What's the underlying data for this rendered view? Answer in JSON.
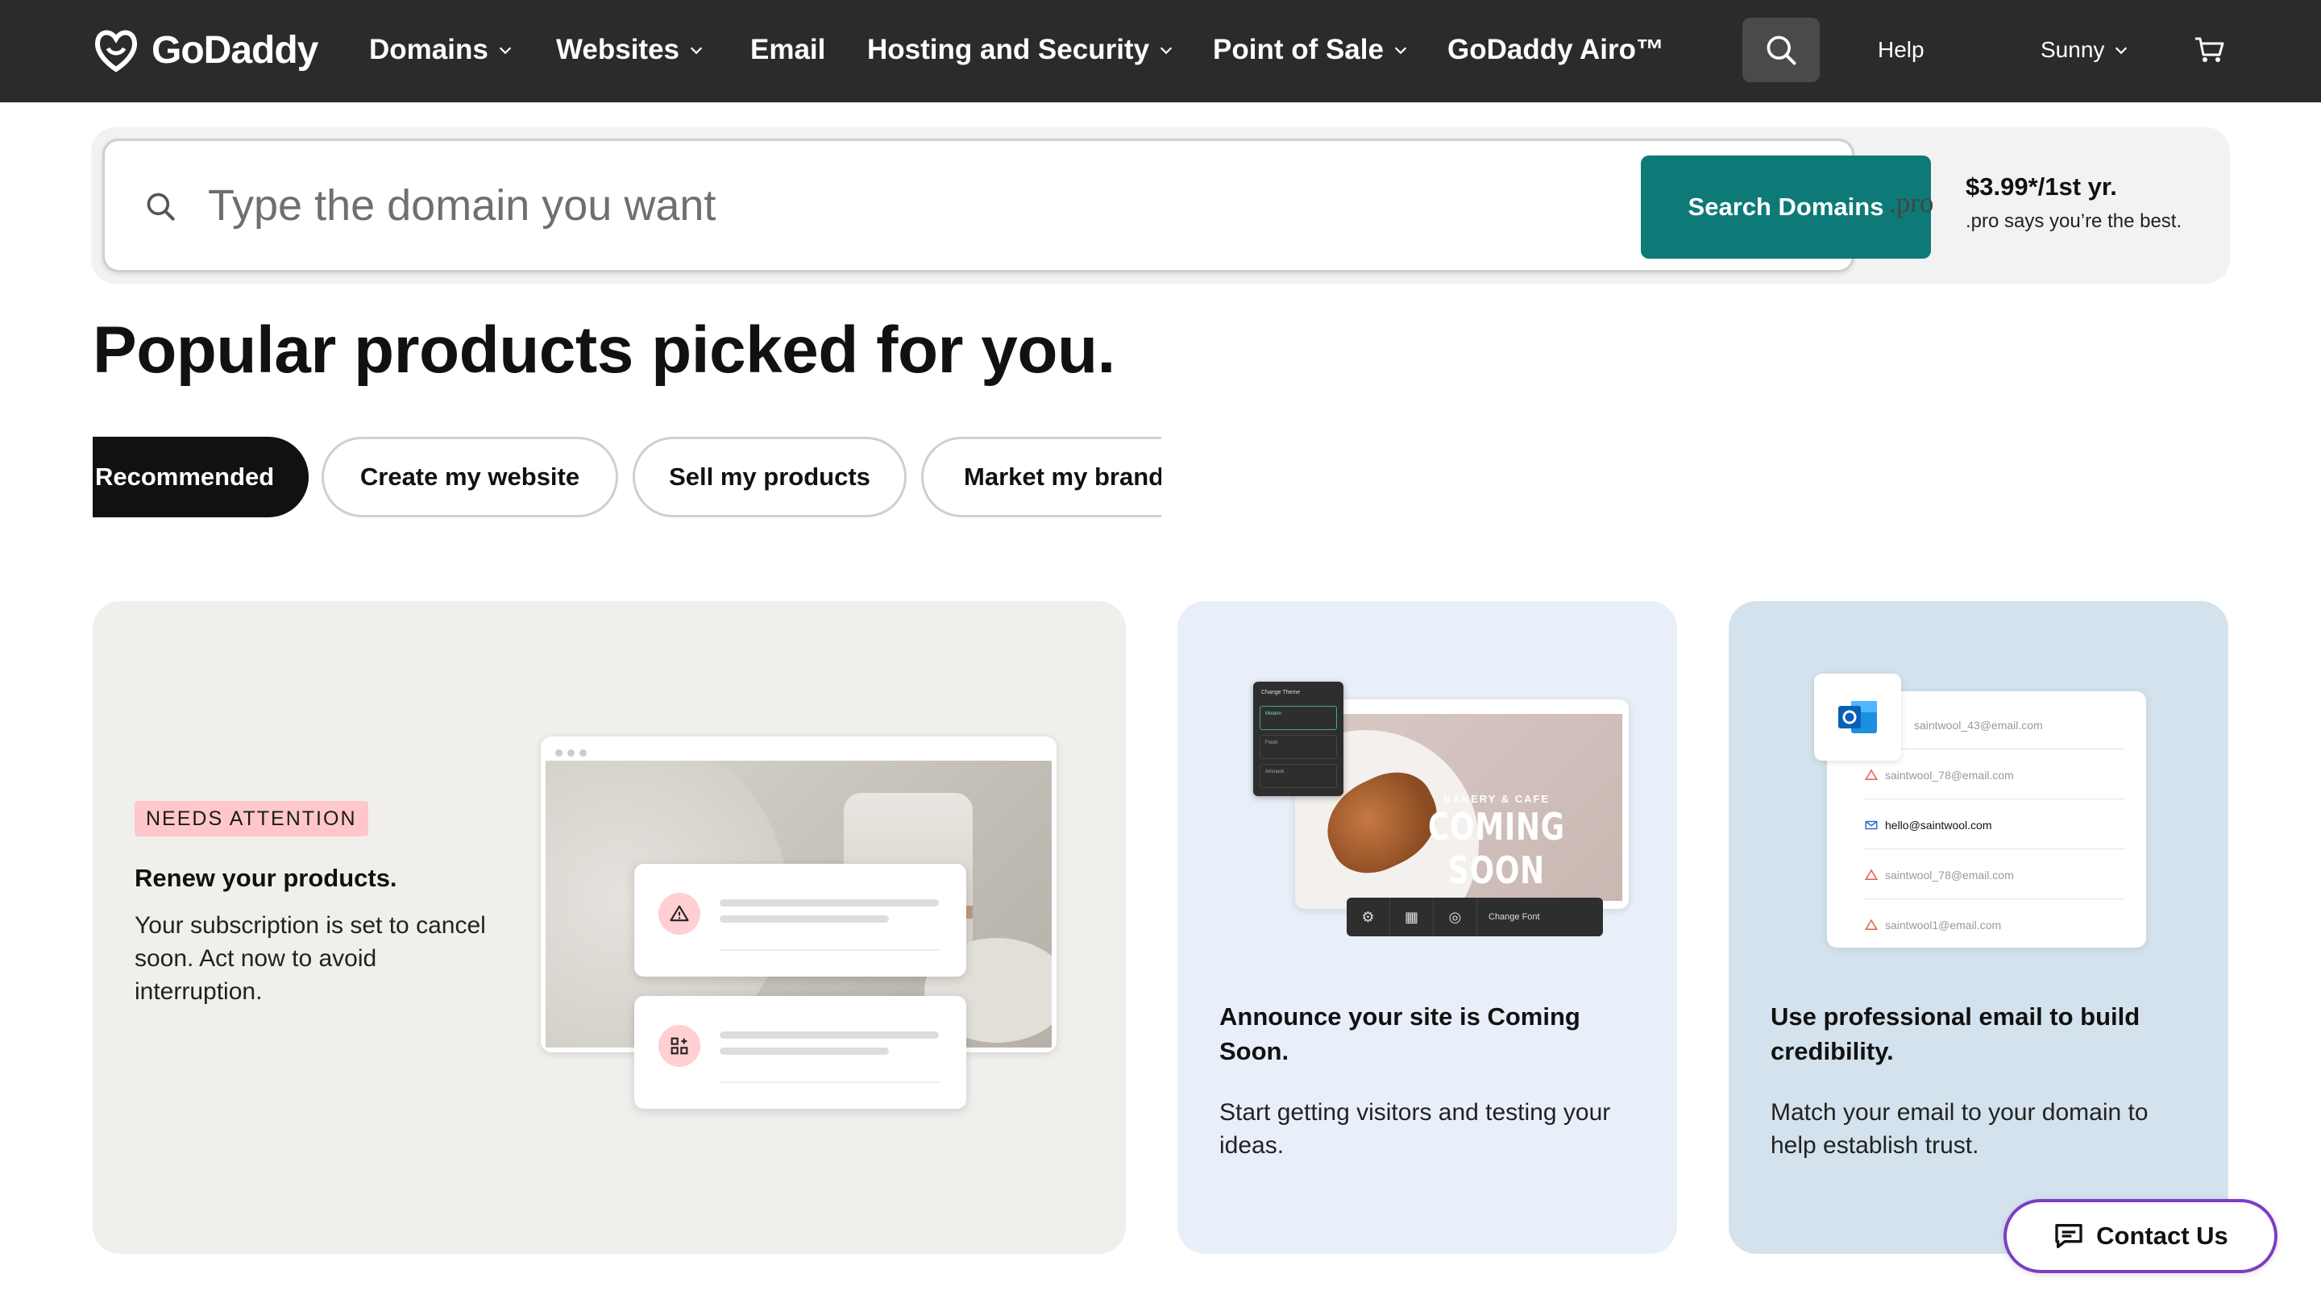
{
  "nav": {
    "logo_text": "GoDaddy",
    "items": [
      {
        "label": "Domains"
      },
      {
        "label": "Websites"
      },
      {
        "label": "Email"
      },
      {
        "label": "Hosting and Security"
      },
      {
        "label": "Point of Sale"
      },
      {
        "label": "GoDaddy Airo™"
      }
    ],
    "help": "Help",
    "user": "Sunny",
    "icons": {
      "search": "search-icon",
      "cart": "cart-icon",
      "chevron": "chevron-down-icon"
    }
  },
  "search": {
    "placeholder": "Type the domain you want",
    "button": "Search Domains",
    "promo_logo": ".pro",
    "promo_price": "$3.99*/1st yr.",
    "promo_text": ".pro says you’re the best."
  },
  "heading": "Popular products picked for you.",
  "tabs": [
    {
      "label": "Recommended",
      "active": true
    },
    {
      "label": "Create my website",
      "active": false
    },
    {
      "label": "Sell my products",
      "active": false
    },
    {
      "label": "Market my brand",
      "active": false
    }
  ],
  "cards": [
    {
      "badge": "NEEDS ATTENTION",
      "title": "Renew your products.",
      "desc": "Your subscription is set to cancel soon. Act now to avoid interruption."
    },
    {
      "title": "Announce your site is Coming Soon.",
      "desc": "Start getting visitors and testing your ideas.",
      "illustration": {
        "panel_title": "Change Theme",
        "options": [
          "Modern",
          "Fresh",
          "Artsnack"
        ],
        "tagline": "BAKERY & CAFE",
        "headline": "COMING SOON",
        "toolbar_font": "Change Font"
      }
    },
    {
      "title": "Use professional email to build credibility.",
      "desc": "Match your email to your domain to help establish trust.",
      "illustration": {
        "emails": [
          {
            "text": "saintwool_43@email.com",
            "status": "warning"
          },
          {
            "text": "saintwool_78@email.com",
            "status": "warning"
          },
          {
            "text": "hello@saintwool.com",
            "status": "ok"
          },
          {
            "text": "saintwool_78@email.com",
            "status": "warning"
          },
          {
            "text": "saintwool1@email.com",
            "status": "warning"
          }
        ]
      }
    }
  ],
  "contact": "Contact Us",
  "colors": {
    "nav_bg": "#2b2b2b",
    "teal": "#0d7a78",
    "badge_pink": "#ffc7cb",
    "card1_bg": "#f0efec",
    "card2_bg": "#e8eff8",
    "card3_bg": "#d3e2ec",
    "contact_border": "#7b3fc4"
  }
}
